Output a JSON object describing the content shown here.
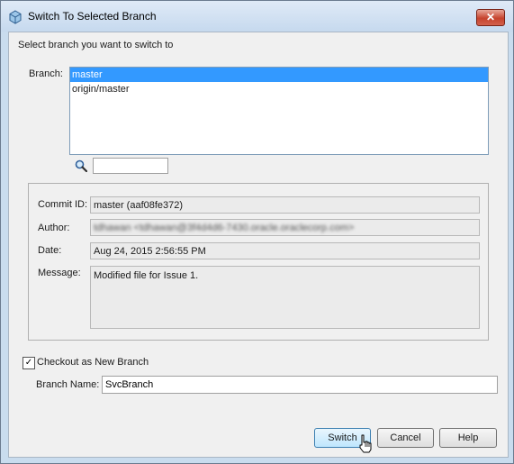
{
  "window": {
    "title": "Switch To Selected Branch",
    "close_label": "✕"
  },
  "prompt": "Select branch you want to switch to",
  "branch": {
    "label": "Branch:",
    "items": [
      {
        "label": "master",
        "selected": true
      },
      {
        "label": "origin/master",
        "selected": false
      }
    ]
  },
  "search": {
    "value": ""
  },
  "details": {
    "commit_label": "Commit ID:",
    "commit_value": "master (aaf08fe372)",
    "author_label": "Author:",
    "author_value": "tdhawan <tdhawan@3f4d4d6-7430.oracle.oraclecorp.com>",
    "date_label": "Date:",
    "date_value": "Aug 24, 2015 2:56:55 PM",
    "message_label": "Message:",
    "message_value": "Modified file for Issue 1."
  },
  "checkout": {
    "label": "Checkout as New Branch",
    "checked": true,
    "check_mark": "✓"
  },
  "branch_name": {
    "label": "Branch Name:",
    "value": "SvcBranch"
  },
  "buttons": {
    "switch": "Switch",
    "cancel": "Cancel",
    "help": "Help"
  },
  "colors": {
    "selection": "#3399ff",
    "titlebar": "#c6d9ee",
    "close": "#c6432d"
  }
}
